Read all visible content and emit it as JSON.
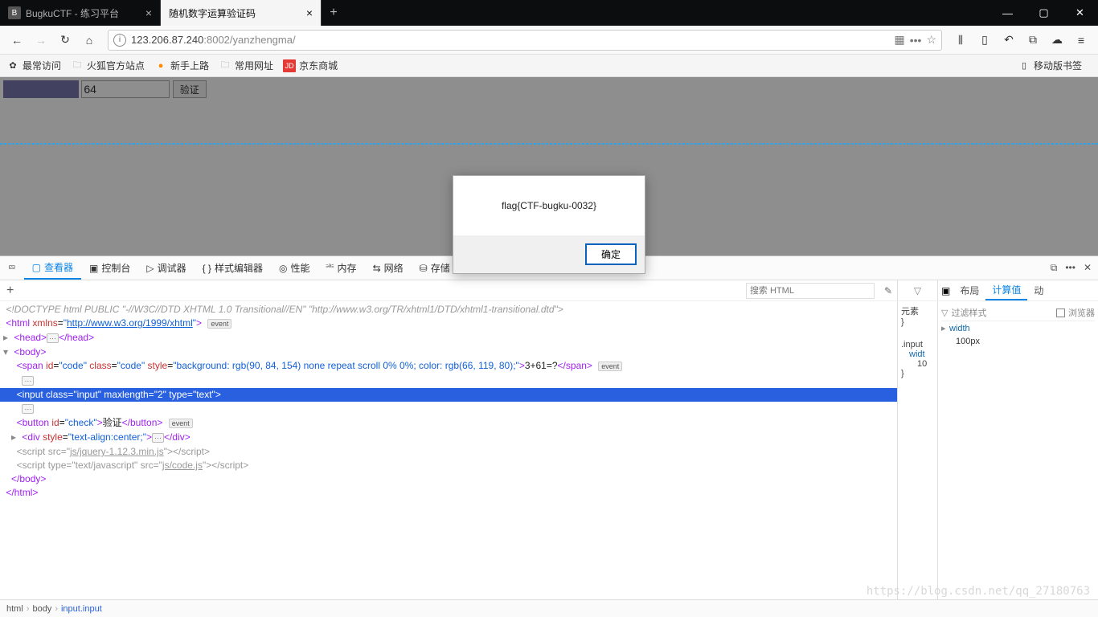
{
  "titlebar": {
    "tabs": [
      {
        "title": "BugkuCTF - 练习平台",
        "active": false
      },
      {
        "title": "随机数字运算验证码",
        "active": true
      }
    ]
  },
  "navbar": {
    "url_prefix": "123.206.87.240",
    "url_port": ":8002",
    "url_path": "/yanzhengma/"
  },
  "bookmarks": {
    "items": [
      "最常访问",
      "火狐官方站点",
      "新手上路",
      "常用网址",
      "京东商城"
    ],
    "mobile": "移动版书签"
  },
  "page": {
    "code_text": "3+61=?",
    "input_value": "64",
    "button_label": "验证"
  },
  "alert": {
    "message": "flag{CTF-bugku-0032}",
    "ok": "确定"
  },
  "devtools": {
    "tabs": [
      "查看器",
      "控制台",
      "调试器",
      "样式编辑器",
      "性能",
      "内存",
      "网络",
      "存储"
    ],
    "search_placeholder": "搜索 HTML",
    "right_tabs": [
      "布局",
      "计算值",
      "动"
    ],
    "side1": {
      "tab": "元素",
      "brace": "}",
      "sel": ".input",
      "prop": "widt",
      "val": "10"
    },
    "side2": {
      "filter": "过滤样式",
      "browser": "浏览器",
      "prop": "width",
      "val": "100px",
      "brace": "}"
    },
    "dom": {
      "doctype": "<!DOCTYPE html PUBLIC \"-//W3C//DTD XHTML 1.0 Transitional//EN\" \"http://www.w3.org/TR/xhtml1/DTD/xhtml1-transitional.dtd\">",
      "html_xmlns": "http://www.w3.org/1999/xhtml",
      "span_style": "background: rgb(90, 84, 154) none repeat scroll 0% 0%; color: rgb(66, 119, 80);",
      "span_text": "3+61=?",
      "btn_text": "验证",
      "div_style": "text-align:center;",
      "jq_src": "js/jquery-1.12.3.min.js",
      "code_src": "js/code.js"
    },
    "breadcrumb": [
      "html",
      "body",
      "input.input"
    ]
  },
  "watermark": "https://blog.csdn.net/qq_27180763"
}
